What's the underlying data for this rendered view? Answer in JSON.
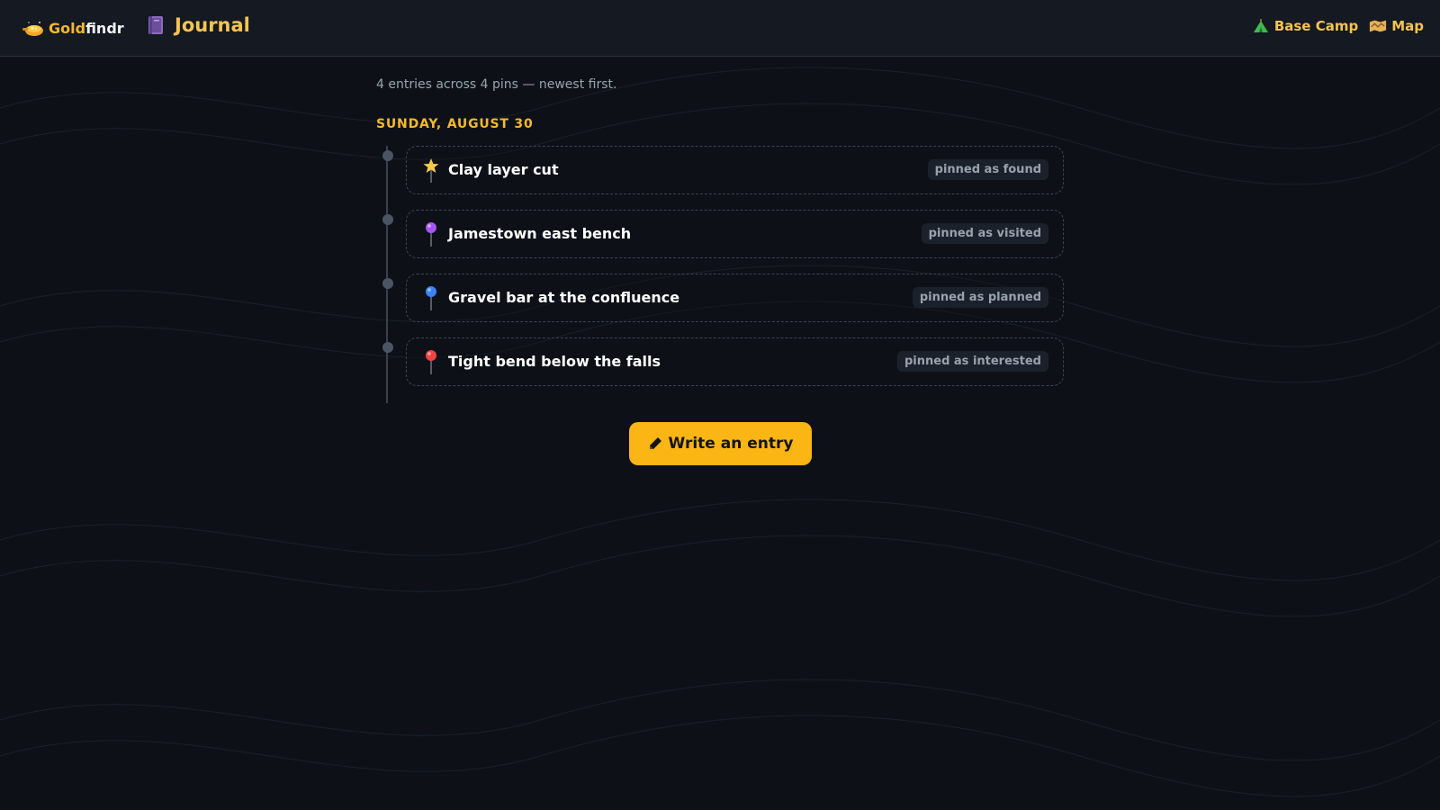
{
  "brand": {
    "name_accent": "Gold",
    "name_rest": "findr",
    "icon": "gold-pan-icon"
  },
  "page": {
    "title": "Journal",
    "icon": "notebook-icon"
  },
  "nav": {
    "base_camp": {
      "label": "Base Camp",
      "icon": "tent-icon"
    },
    "map": {
      "label": "Map",
      "icon": "map-icon"
    }
  },
  "summary": "4 entries across 4 pins — newest first.",
  "date_heading": "SUNDAY, AUGUST 30",
  "entries": [
    {
      "title": "Clay layer cut",
      "status": "pinned as found",
      "icon": "star-pin-icon",
      "pin_color": "#f3c84b"
    },
    {
      "title": "Jamestown east bench",
      "status": "pinned as visited",
      "icon": "purple-pin-icon",
      "pin_color": "#a855f7"
    },
    {
      "title": "Gravel bar at the confluence",
      "status": "pinned as planned",
      "icon": "blue-pin-icon",
      "pin_color": "#3b82f6"
    },
    {
      "title": "Tight bend below the falls",
      "status": "pinned as interested",
      "icon": "red-pin-icon",
      "pin_color": "#ef4444"
    }
  ],
  "write_button": {
    "label": "Write an entry",
    "icon": "pencil-icon"
  },
  "colors": {
    "accent": "#f5b82e",
    "button": "#fbb515",
    "background": "#0d1117"
  }
}
